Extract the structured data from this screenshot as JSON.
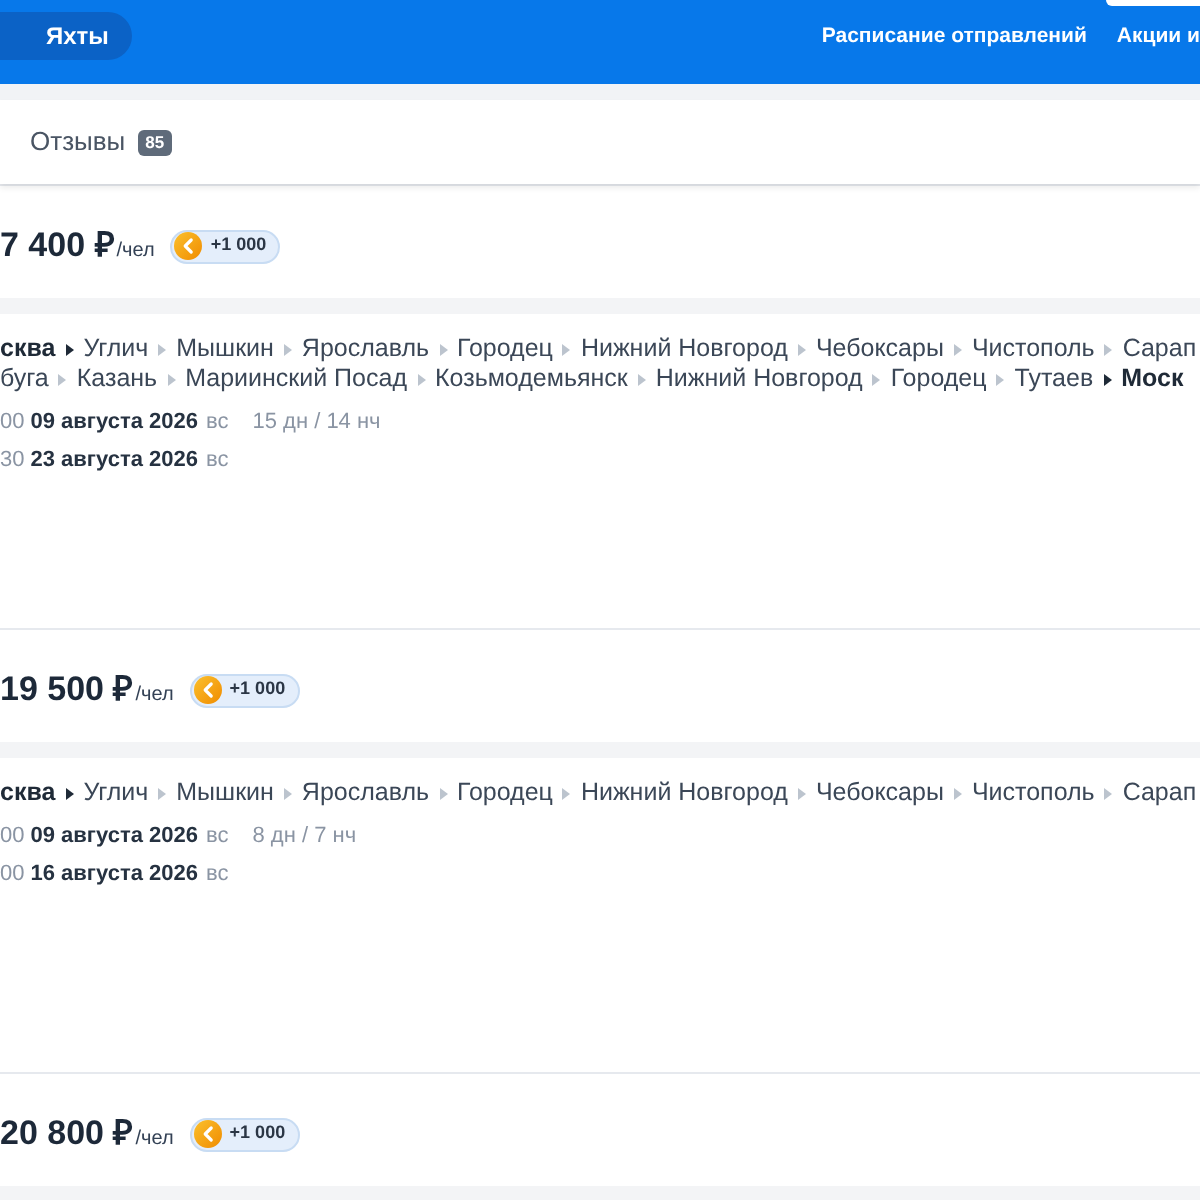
{
  "header": {
    "tabs": [
      {
        "label": "Яхты"
      }
    ],
    "links": [
      "Расписание отправлений",
      "Акции и"
    ]
  },
  "page_tabs": [
    {
      "label": "Отзывы",
      "count": "85"
    }
  ],
  "cruises": [
    {
      "price": "7 400 ₽",
      "per": "/чел",
      "bonus": "+1 000",
      "route_lines": [
        [
          {
            "name": "сква",
            "kind": "terminal"
          },
          {
            "name": "Углич",
            "kind": "stop"
          },
          {
            "name": "Мышкин",
            "kind": "stop"
          },
          {
            "name": "Ярославль",
            "kind": "stop"
          },
          {
            "name": "Городец",
            "kind": "stop"
          },
          {
            "name": "Нижний Новгород",
            "kind": "stop"
          },
          {
            "name": "Чебоксары",
            "kind": "stop"
          },
          {
            "name": "Чистополь",
            "kind": "stop"
          },
          {
            "name": "Сарап",
            "kind": "stop"
          }
        ],
        [
          {
            "name": "буга",
            "kind": "stop"
          },
          {
            "name": "Казань",
            "kind": "stop"
          },
          {
            "name": "Мариинский Посад",
            "kind": "stop"
          },
          {
            "name": "Козьмодемьянск",
            "kind": "stop"
          },
          {
            "name": "Нижний Новгород",
            "kind": "stop"
          },
          {
            "name": "Городец",
            "kind": "stop"
          },
          {
            "name": "Тутаев",
            "kind": "stop"
          },
          {
            "name": "Моск",
            "kind": "terminal"
          }
        ]
      ],
      "departure": {
        "time": "00",
        "date": "09 августа 2026",
        "weekday": "вс",
        "duration": "15 дн / 14 нч"
      },
      "arrival": {
        "time": "30",
        "date": "23 августа 2026",
        "weekday": "вс"
      }
    },
    {
      "price": "19 500 ₽",
      "per": "/чел",
      "bonus": "+1 000",
      "route_lines": [
        [
          {
            "name": "сква",
            "kind": "terminal"
          },
          {
            "name": "Углич",
            "kind": "stop"
          },
          {
            "name": "Мышкин",
            "kind": "stop"
          },
          {
            "name": "Ярославль",
            "kind": "stop"
          },
          {
            "name": "Городец",
            "kind": "stop"
          },
          {
            "name": "Нижний Новгород",
            "kind": "stop"
          },
          {
            "name": "Чебоксары",
            "kind": "stop"
          },
          {
            "name": "Чистополь",
            "kind": "stop"
          },
          {
            "name": "Сарап",
            "kind": "stop"
          }
        ]
      ],
      "departure": {
        "time": "00",
        "date": "09 августа 2026",
        "weekday": "вс",
        "duration": "8 дн / 7 нч"
      },
      "arrival": {
        "time": "00",
        "date": "16 августа 2026",
        "weekday": "вс"
      }
    },
    {
      "price": "20 800 ₽",
      "per": "/чел",
      "bonus": "+1 000"
    }
  ]
}
